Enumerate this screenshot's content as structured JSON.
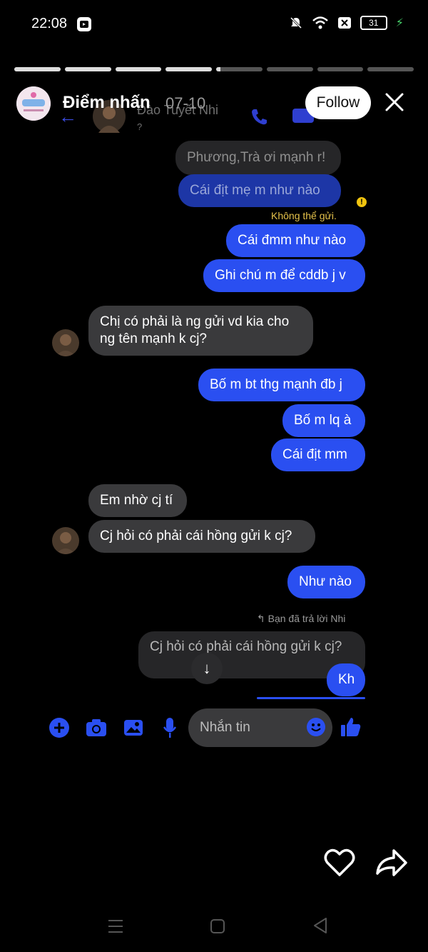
{
  "status": {
    "time": "22:08",
    "battery": "31",
    "icons": [
      "app-notification-icon",
      "mute-icon",
      "wifi-icon",
      "sim-off-icon",
      "battery-icon",
      "charging-icon"
    ]
  },
  "story": {
    "segments_total": 8,
    "segments_viewed": 4,
    "current_segment_progress": 0.1,
    "title": "Điểm nhấn",
    "timestamp": "07-10",
    "follow_label": "Follow"
  },
  "messenger": {
    "contact_name": "Đào Tuyết Nhi",
    "contact_status": "?",
    "messages": [
      {
        "text": "Phương,Trà ơi mạnh r!"
      },
      {
        "text": "Cái địt mẹ m như nào"
      },
      {
        "text": "Cái đmm như nào"
      },
      {
        "text": "Ghi chú m để cddb j v"
      },
      {
        "text": "Chị có phải là ng gửi vd kia cho ng tên mạnh k cj?"
      },
      {
        "text": "Bố m bt thg mạnh đb j"
      },
      {
        "text": "Bố m lq à"
      },
      {
        "text": "Cái địt mm"
      },
      {
        "text": "Em nhờ cj tí"
      },
      {
        "text": "Cj hỏi có phải cái hồng gửi k cj?"
      },
      {
        "text": "Như nào"
      },
      {
        "text": "Cj hỏi có phải cái hồng gửi k cj?"
      },
      {
        "text": "Kh"
      }
    ],
    "failed_label": "Không thể gửi.",
    "reply_note": "Bạn đã trả lời Nhi",
    "composer_placeholder": "Nhắn tin"
  },
  "colors": {
    "sent_bubble": "#2a4ff1",
    "received_bubble": "#3a3a3c",
    "warning": "#f1c40f"
  }
}
